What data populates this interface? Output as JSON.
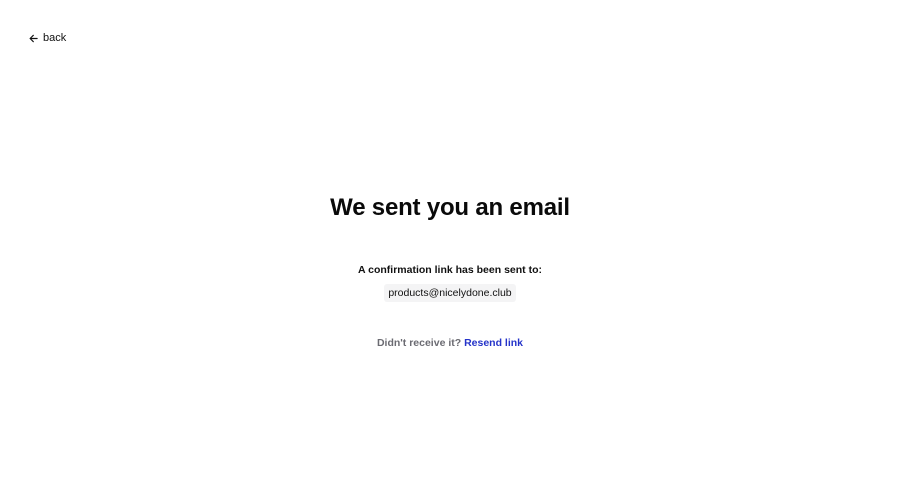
{
  "nav": {
    "back_label": "back"
  },
  "main": {
    "title": "We sent you an email",
    "confirmation_text": "A confirmation link has been sent to:",
    "email": "products@nicelydone.club",
    "not_received_text": "Didn't receive it?",
    "resend_label": "Resend link"
  },
  "colors": {
    "link": "#2433c9",
    "muted": "#6b6b72",
    "chip_bg": "#f4f4f5"
  },
  "icons": {
    "back": "arrow-left-icon"
  }
}
